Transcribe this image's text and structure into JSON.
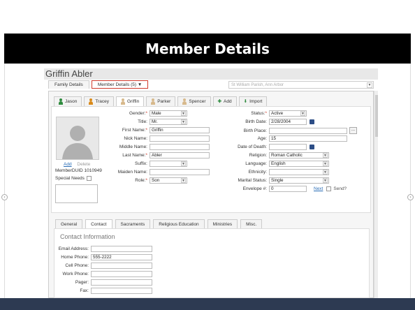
{
  "slide": {
    "title": "Member Details"
  },
  "app": {
    "member_name": "Griffin Abler",
    "top_tabs": [
      {
        "label": "Family Details"
      },
      {
        "label": "Member Details (5) ▼"
      }
    ],
    "parish": "St William Parish, Ann Arbor",
    "member_tabs": [
      {
        "label": "Jason",
        "icon_color": "#2e8b3e"
      },
      {
        "label": "Tracey",
        "icon_color": "#d98a1a"
      },
      {
        "label": "Griffin",
        "icon_color": "#d7b98c"
      },
      {
        "label": "Parker",
        "icon_color": "#d7b98c"
      },
      {
        "label": "Spencer",
        "icon_color": "#d7b98c"
      },
      {
        "label": "Add"
      },
      {
        "label": "Import"
      }
    ],
    "photo_links": {
      "add": "Add",
      "delete": "Delete"
    },
    "member_duid": "MemberDUID 1010949",
    "special_needs": "Special Needs",
    "left_fields": {
      "gender": {
        "label": "Gender:",
        "value": "Male"
      },
      "title": {
        "label": "Title:",
        "value": "Mr."
      },
      "first_name": {
        "label": "First Name:",
        "value": "Griffin"
      },
      "nick_name": {
        "label": "Nick Name:",
        "value": ""
      },
      "middle_name": {
        "label": "Middle Name:",
        "value": ""
      },
      "last_name": {
        "label": "Last Name:",
        "value": "Abler"
      },
      "suffix": {
        "label": "Suffix:",
        "value": ""
      },
      "maiden_name": {
        "label": "Maiden Name:",
        "value": ""
      },
      "role": {
        "label": "Role:",
        "value": "Son"
      }
    },
    "right_fields": {
      "status": {
        "label": "Status:",
        "value": "Active"
      },
      "birth_date": {
        "label": "Birth Date:",
        "value": "2/28/2004"
      },
      "birth_place": {
        "label": "Birth Place:",
        "value": ""
      },
      "age": {
        "label": "Age:",
        "value": "15"
      },
      "date_of_death": {
        "label": "Date of Death:",
        "value": ""
      },
      "religion": {
        "label": "Religion:",
        "value": "Roman Catholic"
      },
      "language": {
        "label": "Language:",
        "value": "English"
      },
      "ethnicity": {
        "label": "Ethnicity:",
        "value": ""
      },
      "marital_status": {
        "label": "Marital Status:",
        "value": "Single"
      },
      "envelope": {
        "label": "Envelope #:",
        "value": "0"
      },
      "next": "Next",
      "send": "Send?"
    },
    "bottom_tabs": [
      {
        "label": "General"
      },
      {
        "label": "Contact"
      },
      {
        "label": "Sacraments"
      },
      {
        "label": "Religious Education"
      },
      {
        "label": "Ministries"
      },
      {
        "label": "Misc."
      }
    ],
    "contact": {
      "title": "Contact Information",
      "fields": [
        {
          "label": "Email Address:",
          "value": ""
        },
        {
          "label": "Home Phone:",
          "value": "555-2222"
        },
        {
          "label": "Cell Phone:",
          "value": ""
        },
        {
          "label": "Work Phone:",
          "value": ""
        },
        {
          "label": "Pager:",
          "value": ""
        },
        {
          "label": "Fax:",
          "value": ""
        }
      ]
    }
  }
}
